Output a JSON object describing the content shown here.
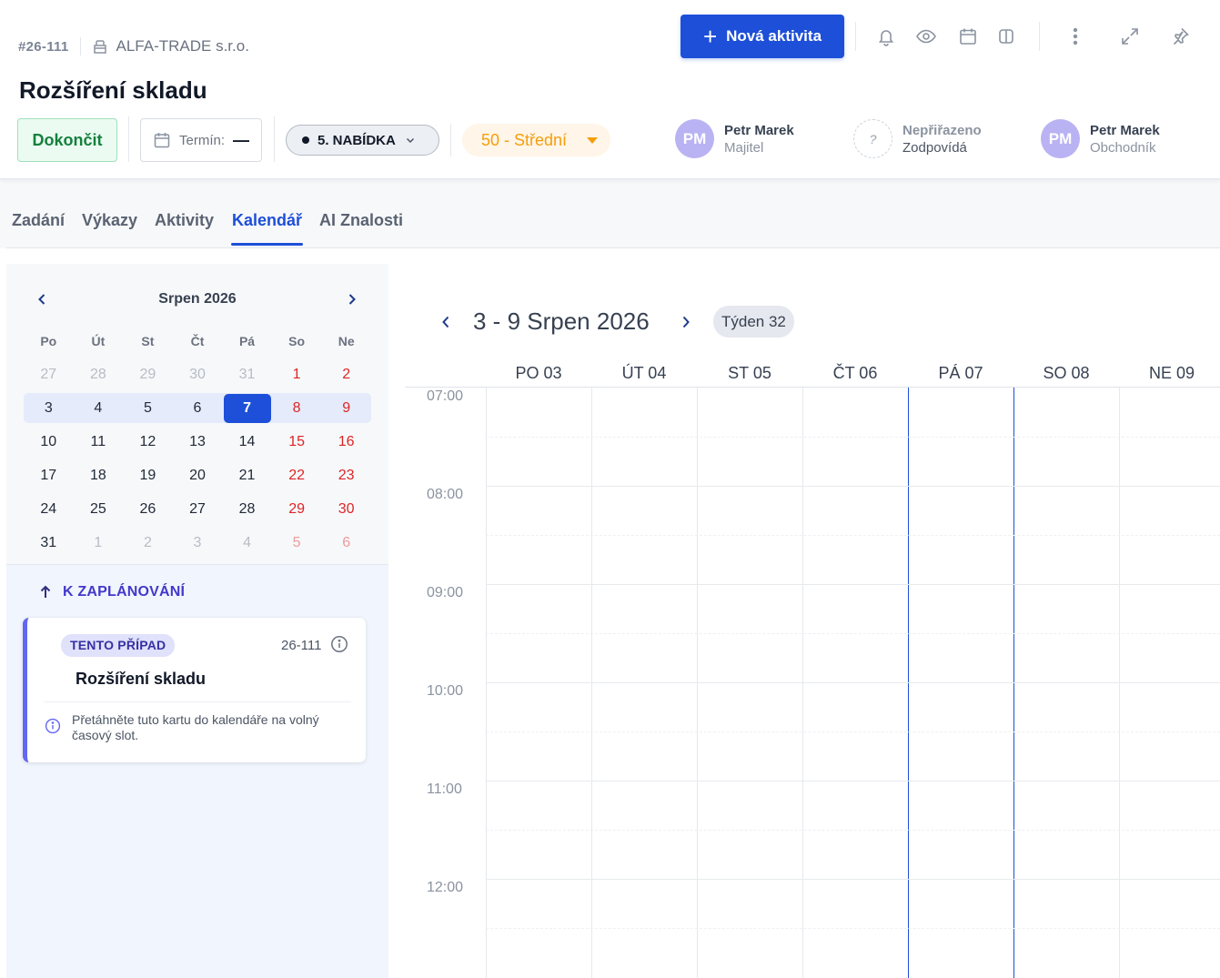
{
  "case": {
    "id": "#26-111",
    "company": "ALFA-TRADE s.r.o.",
    "title": "Rozšíření skladu"
  },
  "toolbar": {
    "new_activity_label": "Nová aktivita",
    "icons": [
      "bell-icon",
      "eye-icon",
      "calendar-icon",
      "columns-icon",
      "more-vertical-icon",
      "expand-icon",
      "pin-icon"
    ]
  },
  "actions": {
    "finish_label": "Dokončit",
    "deadline_label": "Termín:",
    "deadline_value": "—",
    "stage_label": "5. NABÍDKA",
    "priority_label": "50 - Střední"
  },
  "people": [
    {
      "initials": "PM",
      "name": "Petr Marek",
      "role": "Majitel"
    },
    {
      "initials": "?",
      "name": "Nepřiřazeno",
      "role": "Zodpovídá"
    },
    {
      "initials": "PM",
      "name": "Petr Marek",
      "role": "Obchodník"
    }
  ],
  "tabs": [
    {
      "label": "Zadání",
      "active": false
    },
    {
      "label": "Výkazy",
      "active": false
    },
    {
      "label": "Aktivity",
      "active": false
    },
    {
      "label": "Kalendář",
      "active": true
    },
    {
      "label": "AI Znalosti",
      "active": false
    }
  ],
  "mini_calendar": {
    "title": "Srpen 2026",
    "weekdays": [
      "Po",
      "Út",
      "St",
      "Čt",
      "Pá",
      "So",
      "Ne"
    ],
    "weeks": [
      [
        {
          "d": "27",
          "out": true
        },
        {
          "d": "28",
          "out": true
        },
        {
          "d": "29",
          "out": true
        },
        {
          "d": "30",
          "out": true
        },
        {
          "d": "31",
          "out": true
        },
        {
          "d": "1"
        },
        {
          "d": "2"
        }
      ],
      [
        {
          "d": "3"
        },
        {
          "d": "4"
        },
        {
          "d": "5"
        },
        {
          "d": "6"
        },
        {
          "d": "7",
          "today": true
        },
        {
          "d": "8"
        },
        {
          "d": "9"
        }
      ],
      [
        {
          "d": "10"
        },
        {
          "d": "11"
        },
        {
          "d": "12"
        },
        {
          "d": "13"
        },
        {
          "d": "14"
        },
        {
          "d": "15"
        },
        {
          "d": "16"
        }
      ],
      [
        {
          "d": "17"
        },
        {
          "d": "18"
        },
        {
          "d": "19"
        },
        {
          "d": "20"
        },
        {
          "d": "21"
        },
        {
          "d": "22"
        },
        {
          "d": "23"
        }
      ],
      [
        {
          "d": "24"
        },
        {
          "d": "25"
        },
        {
          "d": "26"
        },
        {
          "d": "27"
        },
        {
          "d": "28"
        },
        {
          "d": "29"
        },
        {
          "d": "30"
        }
      ],
      [
        {
          "d": "31"
        },
        {
          "d": "1",
          "out": true
        },
        {
          "d": "2",
          "out": true
        },
        {
          "d": "3",
          "out": true
        },
        {
          "d": "4",
          "out": true
        },
        {
          "d": "5",
          "out": true
        },
        {
          "d": "6",
          "out": true
        }
      ]
    ],
    "selected_week_index": 1
  },
  "schedule": {
    "heading": "K ZAPLÁNOVÁNÍ",
    "card": {
      "badge": "TENTO PŘÍPAD",
      "id": "26-111",
      "title": "Rozšíření skladu",
      "hint": "Přetáhněte tuto kartu do kalendáře na volný časový slot."
    }
  },
  "week_view": {
    "title": "3 - 9 Srpen 2026",
    "week_badge": "Týden 32",
    "days": [
      "PO 03",
      "ÚT 04",
      "ST 05",
      "ČT 06",
      "PÁ 07",
      "SO 08",
      "NE 09"
    ],
    "today_index": 4,
    "hours": [
      "07:00",
      "08:00",
      "09:00",
      "10:00",
      "11:00",
      "12:00"
    ]
  },
  "colors": {
    "accent": "#1d4fd8",
    "weekend": "#dc2626",
    "priority": "#f59e0b",
    "success": "#15803d",
    "schedule": "#4338ca"
  }
}
